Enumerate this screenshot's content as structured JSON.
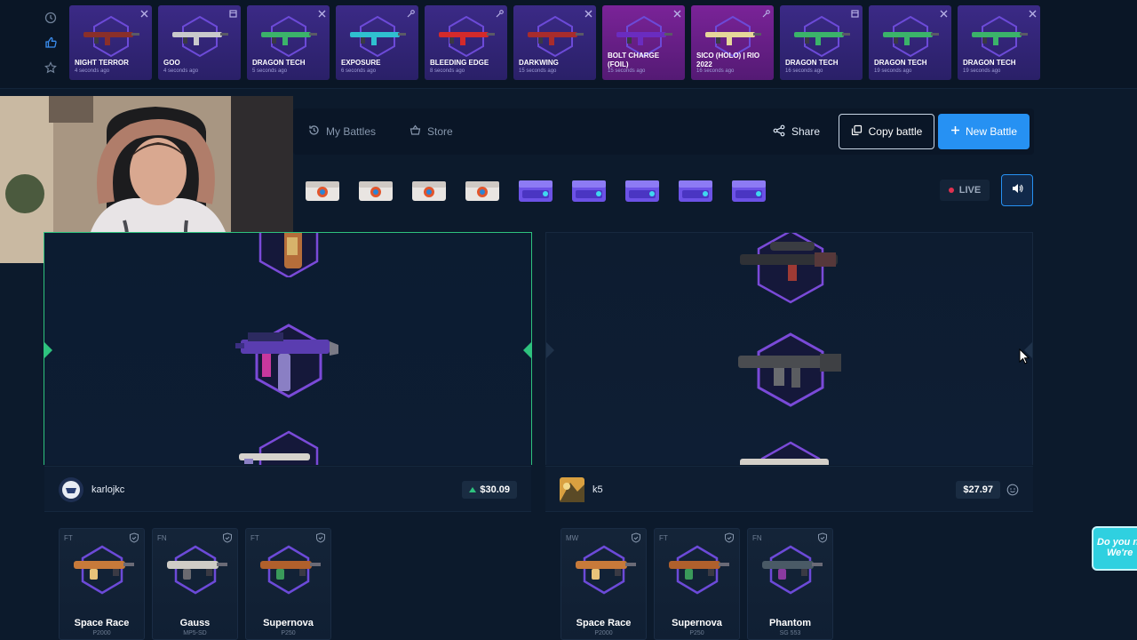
{
  "live_drops": [
    {
      "name": "NIGHT TERROR",
      "time": "4 seconds ago",
      "icon": "x-icon",
      "rarity": "purple"
    },
    {
      "name": "GOO",
      "time": "4 seconds ago",
      "icon": "box-icon",
      "rarity": "purple"
    },
    {
      "name": "DRAGON TECH",
      "time": "5 seconds ago",
      "icon": "x-icon",
      "rarity": "purple"
    },
    {
      "name": "EXPOSURE",
      "time": "6 seconds ago",
      "icon": "key-icon",
      "rarity": "purple"
    },
    {
      "name": "BLEEDING EDGE",
      "time": "8 seconds ago",
      "icon": "key-icon",
      "rarity": "purple"
    },
    {
      "name": "DARKWING",
      "time": "15 seconds ago",
      "icon": "x-icon",
      "rarity": "purple"
    },
    {
      "name": "BOLT CHARGE (FOIL)",
      "time": "15 seconds ago",
      "icon": "x-icon",
      "rarity": "pink"
    },
    {
      "name": "SICO (HOLO) | RIO 2022",
      "time": "16 seconds ago",
      "icon": "key-icon",
      "rarity": "pink"
    },
    {
      "name": "DRAGON TECH",
      "time": "16 seconds ago",
      "icon": "box-icon",
      "rarity": "purple"
    },
    {
      "name": "DRAGON TECH",
      "time": "19 seconds ago",
      "icon": "x-icon",
      "rarity": "purple"
    },
    {
      "name": "DRAGON TECH",
      "time": "19 seconds ago",
      "icon": "x-icon",
      "rarity": "purple"
    }
  ],
  "toolbar": {
    "my_battles": "My Battles",
    "store": "Store",
    "share": "Share",
    "copy_battle": "Copy battle",
    "new_battle": "New Battle"
  },
  "live_label": "LIVE",
  "case_count_orange": 4,
  "case_count_purple": 5,
  "players": [
    {
      "name": "karlojkc",
      "total": "$30.09",
      "items": [
        {
          "wear": "FT",
          "name": "Space Race",
          "type": "P2000"
        },
        {
          "wear": "FN",
          "name": "Gauss",
          "type": "MP5-SD"
        },
        {
          "wear": "FT",
          "name": "Supernova",
          "type": "P250"
        }
      ]
    },
    {
      "name": "k5",
      "total": "$27.97",
      "items": [
        {
          "wear": "MW",
          "name": "Space Race",
          "type": "P2000"
        },
        {
          "wear": "FT",
          "name": "Supernova",
          "type": "P250"
        },
        {
          "wear": "FN",
          "name": "Phantom",
          "type": "SG 553"
        }
      ]
    }
  ],
  "chat": {
    "line1": "Do you n",
    "line2": "We're"
  },
  "colors": {
    "accent": "#2691f3",
    "winner": "#2ec27e",
    "purple": "#7a4ad8"
  }
}
